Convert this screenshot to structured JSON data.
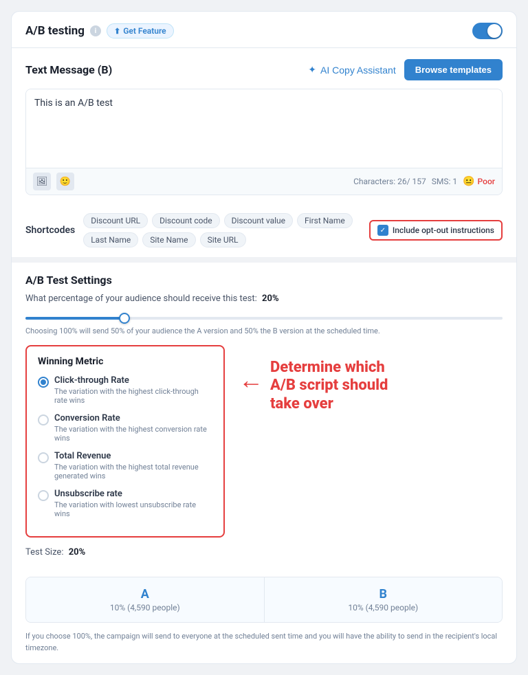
{
  "header": {
    "title": "A/B testing",
    "get_feature_label": "Get Feature",
    "toggle_on": true
  },
  "text_message": {
    "section_title": "Text Message (B)",
    "ai_copy_label": "AI Copy Assistant",
    "browse_templates_label": "Browse templates",
    "textarea_value": "This is an A/B test",
    "characters_label": "Characters: 26/ 157",
    "sms_label": "SMS: 1",
    "quality_emoji": "😐",
    "quality_label": "Poor",
    "toolbar_icon1": "🖼",
    "toolbar_icon2": "😊"
  },
  "shortcodes": {
    "label": "Shortcodes",
    "tags": [
      "Discount URL",
      "Discount code",
      "Discount value",
      "First Name",
      "Last Name",
      "Site Name",
      "Site URL"
    ],
    "opt_out_label": "Include opt-out instructions"
  },
  "ab_settings": {
    "title": "A/B Test Settings",
    "percentage_question": "What percentage of your audience should receive this test:",
    "percentage_value": "20%",
    "slider_hint": "Choosing 100% will send 50% of your audience the A version and 50% the B version at the scheduled time.",
    "winning_metric_title": "Winning Metric",
    "metrics": [
      {
        "name": "Click-through Rate",
        "desc": "The variation with the highest click-through rate wins",
        "selected": true
      },
      {
        "name": "Conversion Rate",
        "desc": "The variation with the highest conversion rate wins",
        "selected": false
      },
      {
        "name": "Total Revenue",
        "desc": "The variation with the highest total revenue generated wins",
        "selected": false
      },
      {
        "name": "Unsubscribe rate",
        "desc": "The variation with lowest unsubscribe rate wins",
        "selected": false
      }
    ],
    "annotation_line1": "Determine which",
    "annotation_line2": "A/B script should",
    "annotation_line3": "take over",
    "test_size_label": "Test Size:",
    "test_size_value": "20%",
    "col_a_letter": "A",
    "col_a_detail": "10% (4,590 people)",
    "col_b_letter": "B",
    "col_b_detail": "10% (4,590 people)",
    "footer_note": "If you choose 100%, the campaign will send to everyone at the scheduled sent time and you will have the ability to send in the recipient's local timezone."
  }
}
